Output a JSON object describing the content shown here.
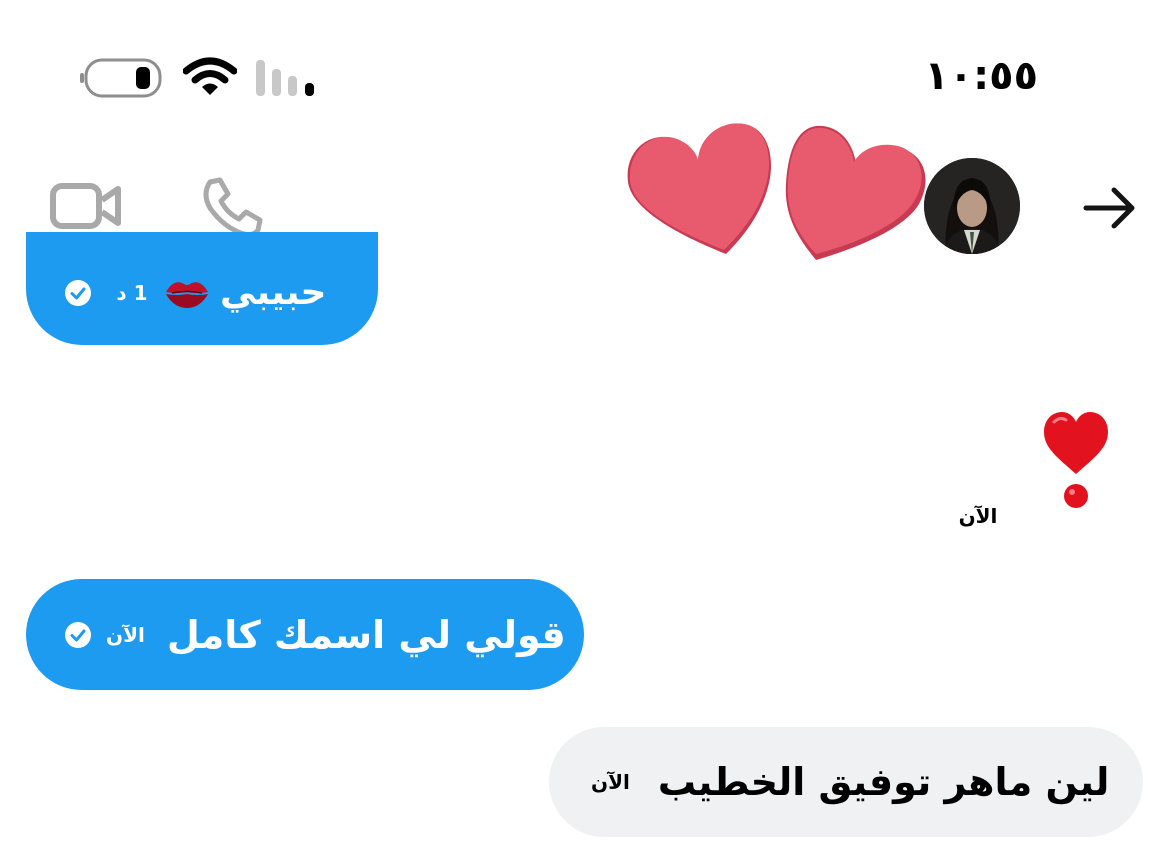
{
  "status_bar": {
    "time": "١٠:٥٥",
    "battery_icon": "battery-icon",
    "wifi_icon": "wifi-icon",
    "signal_icon": "signal-icon"
  },
  "header": {
    "video_icon": "video-camera-icon",
    "call_icon": "phone-icon",
    "contact_name_icon": "two-hearts-icon",
    "avatar": "avatar",
    "back_icon": "arrow-right-icon"
  },
  "messages": [
    {
      "side": "left",
      "text": "حبيبي",
      "emoji": "kiss-mark-icon",
      "time": "1 د",
      "read_icon": "check-circle-icon"
    },
    {
      "side": "right",
      "emoji": "heavy-heart-exclamation-icon",
      "time": "الآن"
    },
    {
      "side": "left",
      "text": "قولي لي اسمك كامل",
      "time": "الآن",
      "read_icon": "check-circle-icon"
    },
    {
      "side": "right",
      "text": "لين ماهر توفيق الخطيب",
      "time": "الآن"
    }
  ],
  "colors": {
    "outgoing_bubble": "#1d9bf0",
    "incoming_bubble": "#eff1f3",
    "heart": "#e85a6e",
    "icon_grey": "#a9a9a9"
  }
}
